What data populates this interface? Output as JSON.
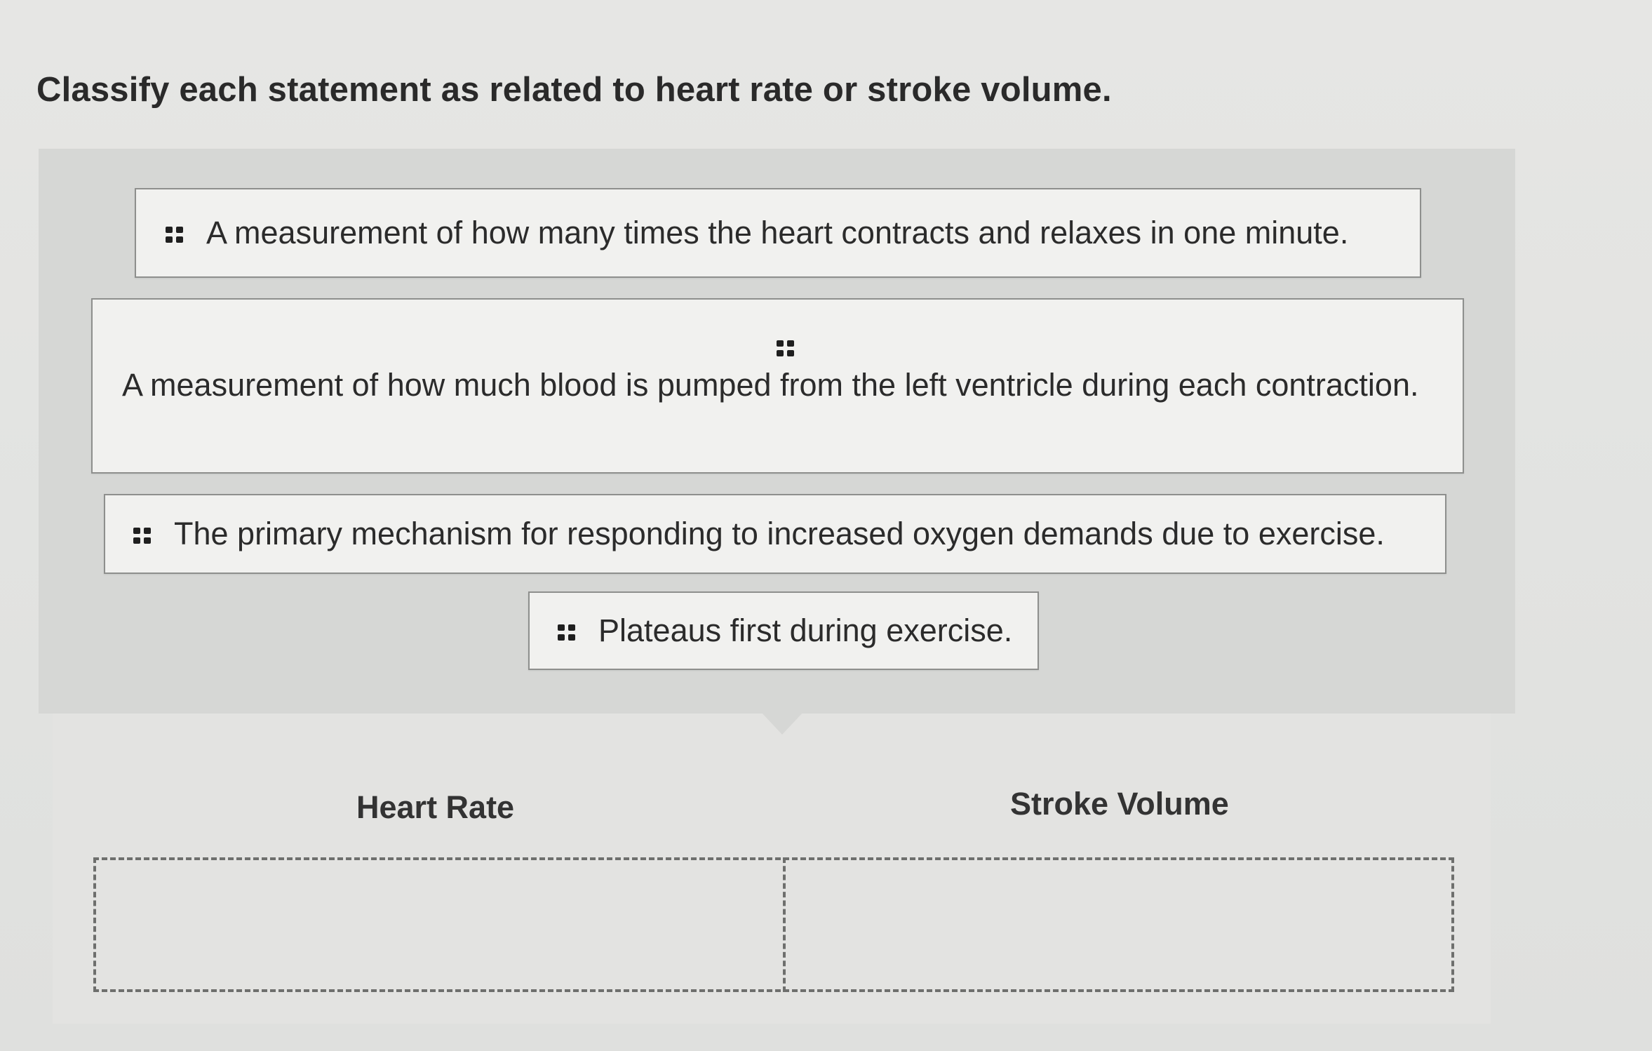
{
  "question": "Classify each statement as related to heart rate or stroke volume.",
  "statements": [
    {
      "text": "A measurement of how many times the heart contracts and relaxes in one minute.",
      "icon": "drag-handle-icon"
    },
    {
      "text": "A measurement of how much blood is pumped from the left ventricle during each contraction.",
      "icon": "drag-handle-icon"
    },
    {
      "text": "The primary mechanism for responding to increased oxygen demands due to exercise.",
      "icon": "drag-handle-icon"
    },
    {
      "text": "Plateaus first during exercise.",
      "icon": "drag-handle-icon"
    }
  ],
  "categories": [
    {
      "label": "Heart Rate"
    },
    {
      "label": "Stroke Volume"
    }
  ],
  "colors": {
    "page_background": "#e4e5e3",
    "card_area": "#d6d7d5",
    "tile_background": "#f1f1ef",
    "tile_border": "#8e8f8d",
    "dashed_border": "#6e6f6d"
  }
}
